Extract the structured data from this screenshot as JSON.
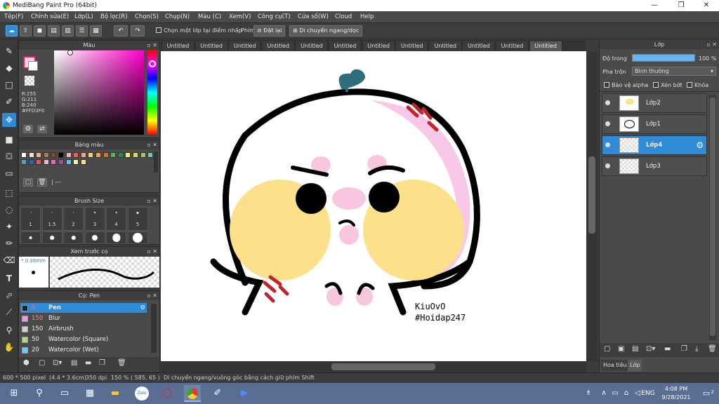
{
  "window": {
    "title": "MediBang Paint Pro (64bit)"
  },
  "menu": [
    "Tệp(F)",
    "Chỉnh sửa(E)",
    "Lớp(L)",
    "Bộ lọc(R)",
    "Chọn(S)",
    "Chụp(N)",
    "Màu (C)",
    "Xem(V)",
    "Công cụ(T)",
    "Cửa số(W)",
    "Cloud",
    "Help"
  ],
  "toolbar": {
    "select_point_label": "Chọn một lớp tại điểm nhấp",
    "keys_label": "Phím",
    "reset_label": "Đặt lại",
    "move_label": "Di chuyển ngang/dọc"
  },
  "color_panel": {
    "title": "Màu",
    "r": "R:255",
    "g": "G:211",
    "b": "B:240",
    "hex": "#FFD3F0",
    "main_color": "#ffd3f0"
  },
  "palette": {
    "title": "Bảng màu",
    "colors": [
      "#ffffff",
      "#f8e0c0",
      "#e8b48a",
      "#b07850",
      "#7a4a2a",
      "#000000",
      "#f7b0b0",
      "#e86060",
      "#f0a0a0",
      "#f8d070",
      "#f4a040",
      "#c87828",
      "#58b060",
      "#2a8848",
      "#f8f070",
      "#d0e060",
      "#a0c850",
      "#78c8a0",
      "#50a0c8",
      "#2868b0",
      "#f05050",
      "#f8b0d0",
      "#d870b0",
      "#a050a0",
      "#60c0e0",
      "#f8f0b0",
      "#f8e090"
    ],
    "footer": "---"
  },
  "brush_size": {
    "title": "Brush Size",
    "sizes": [
      "1",
      "1.5",
      "2",
      "3",
      "4",
      "5"
    ]
  },
  "preview": {
    "title": "Xem trước cọ",
    "size": "0.36mm"
  },
  "brushes": {
    "title": "Cọ: Pen",
    "items": [
      {
        "size": "5",
        "name": "Pen",
        "color": "#222222"
      },
      {
        "size": "150",
        "name": "Blur",
        "color": "#f890e8"
      },
      {
        "size": "150",
        "name": "Airbrush",
        "color": "#d0d0d0"
      },
      {
        "size": "50",
        "name": "Watercolor (Square)",
        "color": "#a8e070"
      },
      {
        "size": "20",
        "name": "Watercolor (Wet)",
        "color": "#70c8f0"
      }
    ]
  },
  "tabs": [
    "Untitled",
    "Untitled",
    "Untitled",
    "Untitled",
    "Untitled",
    "Untitled",
    "Untitled",
    "Untitled",
    "Untitled",
    "Untitled",
    "Untitled",
    "Untitled"
  ],
  "canvas": {
    "sig1": "KiuOvO",
    "sig2": "#Hoidap247"
  },
  "layer_panel": {
    "title": "Lớp",
    "opacity_label": "Độ trong",
    "opacity_value": "100 %",
    "opacity": 1.0,
    "blend_label": "Pha trộn",
    "blend_value": "Bình thường",
    "alpha_lock": "Bảo vệ alpha",
    "clip": "Xén bớt",
    "lock": "Khóa",
    "layers": [
      "Lớp2",
      "Lớp1",
      "Lớp4",
      "Lớp3"
    ],
    "bottom_tabs": [
      "Hoa tiêu",
      "Lớp"
    ]
  },
  "status": {
    "size": "600 * 500 pixel",
    "physical": "(4.4 * 3.6cm)",
    "dpi": "350 dpi",
    "zoom": "150 %",
    "coords": "( 585, 65 )",
    "hint": "Di chuyển ngang/vuông góc bằng cách giữ phím Shift"
  },
  "taskbar": {
    "lang": "ENG",
    "time": "4:08 PM",
    "date": "9/28/2021",
    "notif": "2"
  }
}
